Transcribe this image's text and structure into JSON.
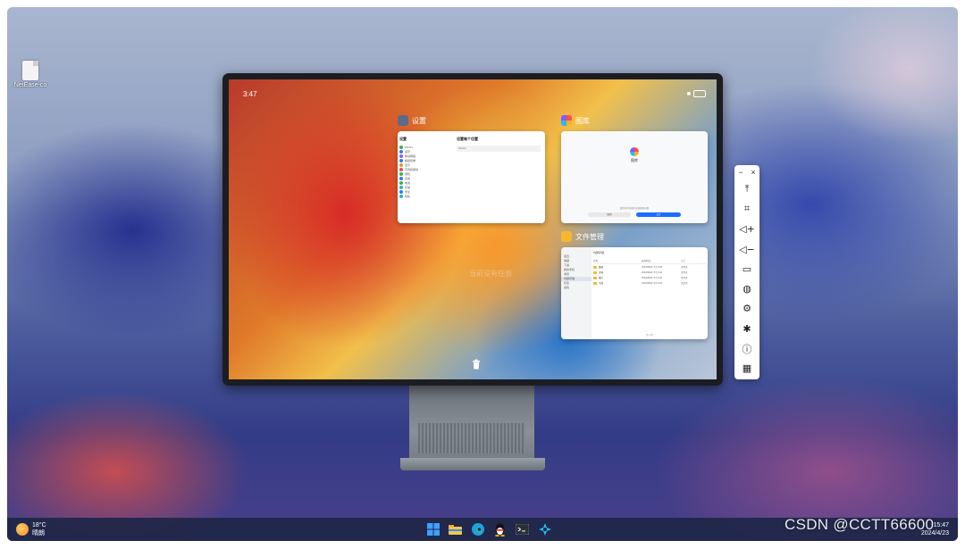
{
  "desktop": {
    "icon_label": "NetEase-co"
  },
  "device": {
    "clock": "3:47",
    "battery": "100",
    "hint": "当前没有任务",
    "settings_card": {
      "title": "设置",
      "left_title": "设置",
      "items": [
        "WLAN",
        "蓝牙",
        "移动网络",
        "超级终端",
        "显示",
        "声音和振动",
        "通知",
        "应用",
        "电池",
        "存储",
        "安全",
        "隐私"
      ],
      "right_title": "设置每个位置",
      "right_row": "WLAN"
    },
    "gallery_card": {
      "title": "图库",
      "app_name": "图库",
      "tip": "请授予访问图片和视频的权限",
      "btn_cancel": "取消",
      "btn_ok": "允许"
    },
    "files_card": {
      "title": "文件管理",
      "sidebar": [
        "最近",
        "收藏",
        "下载",
        "我的手机",
        "浏览",
        "内部存储",
        "标签",
        "蓝色"
      ],
      "crumb": "内部存储",
      "headers": [
        "名称",
        "修改时间",
        "大小"
      ],
      "rows": [
        {
          "name": "数据",
          "date": "2023/08/20 下午3:40",
          "type": "文件夹"
        },
        {
          "name": "文档",
          "date": "2023/08/20 下午3:40",
          "type": "文件夹"
        },
        {
          "name": "图片",
          "date": "2023/08/20 下午3:40",
          "type": "文件夹"
        },
        {
          "name": "下载",
          "date": "2023/08/20 下午3:40",
          "type": "文件夹"
        }
      ],
      "footer": "共 4 项"
    }
  },
  "toolbar": {
    "minimize": "−",
    "close": "×",
    "buttons": [
      {
        "icon": "pin-top-icon",
        "glyph": "⤒"
      },
      {
        "icon": "crop-icon",
        "glyph": "⌗"
      },
      {
        "icon": "volume-up-icon",
        "glyph": "◁+"
      },
      {
        "icon": "volume-down-icon",
        "glyph": "◁−"
      },
      {
        "icon": "screen-icon",
        "glyph": "▭"
      },
      {
        "icon": "globe-icon",
        "glyph": "◍"
      },
      {
        "icon": "settings-icon",
        "glyph": "⚙"
      },
      {
        "icon": "debug-icon",
        "glyph": "✱"
      },
      {
        "icon": "info-icon",
        "glyph": "ⓘ"
      },
      {
        "icon": "keyboard-icon",
        "glyph": "▦"
      }
    ]
  },
  "taskbar": {
    "temp": "18°C",
    "weather": "晴朗",
    "weather_badge": "1",
    "time": "15:47",
    "date": "2024/4/23",
    "watermark": "CSDN @CCTT66600"
  }
}
